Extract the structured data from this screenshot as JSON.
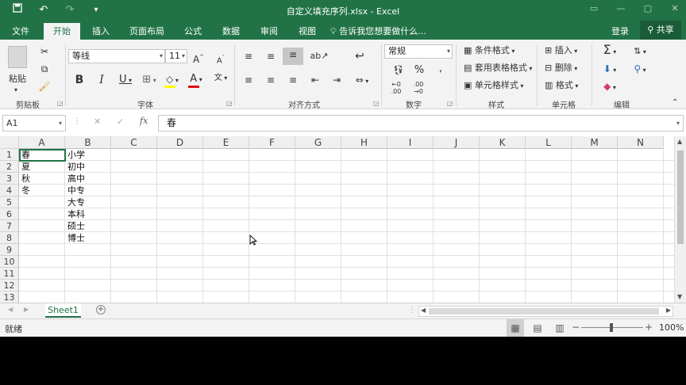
{
  "titlebar": {
    "title": "自定义填充序列.xlsx - Excel"
  },
  "tabs": {
    "file": "文件",
    "home": "开始",
    "insert": "插入",
    "page_layout": "页面布局",
    "formulas": "公式",
    "data": "数据",
    "review": "审阅",
    "view": "视图",
    "tell_me": "告诉我您想要做什么...",
    "login": "登录",
    "share": "共享"
  },
  "ribbon": {
    "clipboard": {
      "paste": "粘贴",
      "label": "剪贴板"
    },
    "font": {
      "name": "等线",
      "size": "11",
      "label": "字体"
    },
    "alignment": {
      "label": "对齐方式"
    },
    "number": {
      "format": "常规",
      "label": "数字"
    },
    "styles": {
      "conditional": "条件格式",
      "table": "套用表格格式",
      "cell_styles": "单元格样式",
      "label": "样式"
    },
    "cells": {
      "insert": "插入",
      "delete": "删除",
      "format": "格式",
      "label": "单元格"
    },
    "editing": {
      "label": "编辑"
    }
  },
  "formula_bar": {
    "name_box": "A1",
    "content": "春"
  },
  "columns": [
    "A",
    "B",
    "C",
    "D",
    "E",
    "F",
    "G",
    "H",
    "I",
    "J",
    "K",
    "L",
    "M",
    "N"
  ],
  "rows": [
    "1",
    "2",
    "3",
    "4",
    "5",
    "6",
    "7",
    "8",
    "9",
    "10",
    "11",
    "12",
    "13"
  ],
  "cells": {
    "A": [
      "春",
      "夏",
      "秋",
      "冬"
    ],
    "B": [
      "小学",
      "初中",
      "高中",
      "中专",
      "大专",
      "本科",
      "硕士",
      "博士"
    ]
  },
  "sheet": {
    "name": "Sheet1"
  },
  "status": {
    "ready": "就绪",
    "zoom": "100%"
  }
}
